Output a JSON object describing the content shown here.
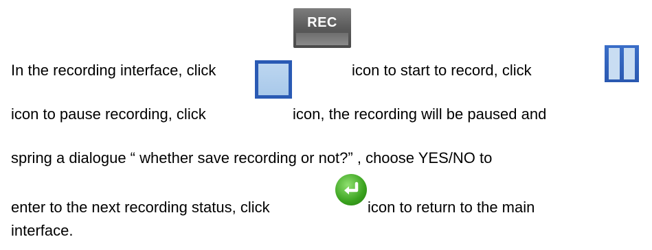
{
  "text": {
    "line1": {
      "part1": "In the recording interface, click",
      "part2": "icon to start to record, click"
    },
    "line2": {
      "part1": "icon to pause recording, click",
      "part2": "icon, the recording will be paused and"
    },
    "line3": "spring a dialogue “ whether save recording or not?” , choose YES/NO to",
    "line4": {
      "part1": "enter to the next recording status, click",
      "part2": "icon to return to the main"
    },
    "line5": "interface."
  },
  "icons": {
    "rec": {
      "name": "rec-icon",
      "label": "REC",
      "color": "#5a5a5a"
    },
    "pause": {
      "name": "pause-icon",
      "color": "#2a58b0"
    },
    "stop": {
      "name": "stop-icon",
      "color": "#2a5ab4"
    },
    "return": {
      "name": "return-icon",
      "color": "#3aa21e"
    }
  }
}
